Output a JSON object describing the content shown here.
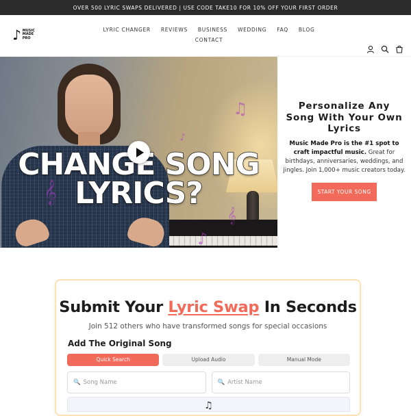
{
  "announcement": "OVER 500 LYRIC SWAPS DELIVERED | USE CODE TAKE10 FOR 10% OFF YOUR FIRST ORDER",
  "logo": {
    "line1": "MUSIC",
    "line2": "MADE",
    "line3": "PRO"
  },
  "nav": [
    "LYRIC CHANGER",
    "REVIEWS",
    "BUSINESS",
    "WEDDING",
    "FAQ",
    "BLOG",
    "CONTACT"
  ],
  "header_icons": [
    "account-icon",
    "search-icon",
    "cart-icon"
  ],
  "hero": {
    "video_overlay_line1": "CHANGE SONG",
    "video_overlay_line2": "LYRICS?",
    "title": "Personalize Any Song With Your Own Lyrics",
    "desc_bold": "Music Made Pro is the #1 spot to craft impactful music.",
    "desc_rest": " Great for birthdays, anniversaries, weddings, and jingles. Join 1,000+ music creators today.",
    "cta": "START YOUR SONG"
  },
  "submit": {
    "title_pre": "Submit Your ",
    "title_highlight": "Lyric Swap",
    "title_post": " In Seconds",
    "subtitle": "Join 512 others who have transformed songs for special occasions",
    "section_title": "Add The Original Song",
    "tabs": [
      "Quick Search",
      "Upload Audio",
      "Manual Mode"
    ],
    "active_tab": "Quick Search",
    "song_placeholder": "Song Name",
    "artist_placeholder": "Artist Name"
  },
  "colors": {
    "accent": "#f26b5a",
    "announce_bg": "#2b2b2b",
    "card_border": "#fde2b5"
  }
}
